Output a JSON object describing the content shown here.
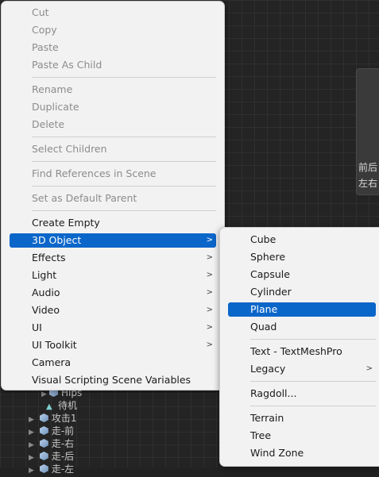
{
  "scene": {
    "line1": "前后",
    "line2": "左右"
  },
  "hierarchy": {
    "rows": [
      {
        "label": "Hips",
        "icon": "cube-icon"
      },
      {
        "label": "待机",
        "icon": "animation-clip-icon"
      },
      {
        "label": "攻击1",
        "icon": "cube-icon"
      },
      {
        "label": "走-前",
        "icon": "cube-icon"
      },
      {
        "label": "走-右",
        "icon": "cube-icon"
      },
      {
        "label": "走-后",
        "icon": "cube-icon"
      },
      {
        "label": "走-左",
        "icon": "cube-icon"
      }
    ]
  },
  "context_menu": {
    "items": [
      {
        "label": "Cut",
        "enabled": false
      },
      {
        "label": "Copy",
        "enabled": false
      },
      {
        "label": "Paste",
        "enabled": false
      },
      {
        "label": "Paste As Child",
        "enabled": false
      },
      {
        "label": "Rename",
        "enabled": false
      },
      {
        "label": "Duplicate",
        "enabled": false
      },
      {
        "label": "Delete",
        "enabled": false
      },
      {
        "label": "Select Children",
        "enabled": false
      },
      {
        "label": "Find References in Scene",
        "enabled": false
      },
      {
        "label": "Set as Default Parent",
        "enabled": false
      },
      {
        "label": "Create Empty",
        "enabled": true
      },
      {
        "label": "3D Object",
        "enabled": true,
        "submenu": true,
        "highlighted": true
      },
      {
        "label": "Effects",
        "enabled": true,
        "submenu": true
      },
      {
        "label": "Light",
        "enabled": true,
        "submenu": true
      },
      {
        "label": "Audio",
        "enabled": true,
        "submenu": true
      },
      {
        "label": "Video",
        "enabled": true,
        "submenu": true
      },
      {
        "label": "UI",
        "enabled": true,
        "submenu": true
      },
      {
        "label": "UI Toolkit",
        "enabled": true,
        "submenu": true
      },
      {
        "label": "Camera",
        "enabled": true
      },
      {
        "label": "Visual Scripting Scene Variables",
        "enabled": true
      }
    ]
  },
  "submenu_3d": {
    "items": [
      {
        "label": "Cube"
      },
      {
        "label": "Sphere"
      },
      {
        "label": "Capsule"
      },
      {
        "label": "Cylinder"
      },
      {
        "label": "Plane",
        "highlighted": true
      },
      {
        "label": "Quad"
      },
      {
        "label": "Text - TextMeshPro"
      },
      {
        "label": "Legacy",
        "submenu": true
      },
      {
        "label": "Ragdoll..."
      },
      {
        "label": "Terrain"
      },
      {
        "label": "Tree"
      },
      {
        "label": "Wind Zone"
      }
    ]
  },
  "colors": {
    "highlight": "#0b66c9",
    "menu_bg": "#f2f2f2",
    "disabled_text": "#8c8c8c"
  }
}
